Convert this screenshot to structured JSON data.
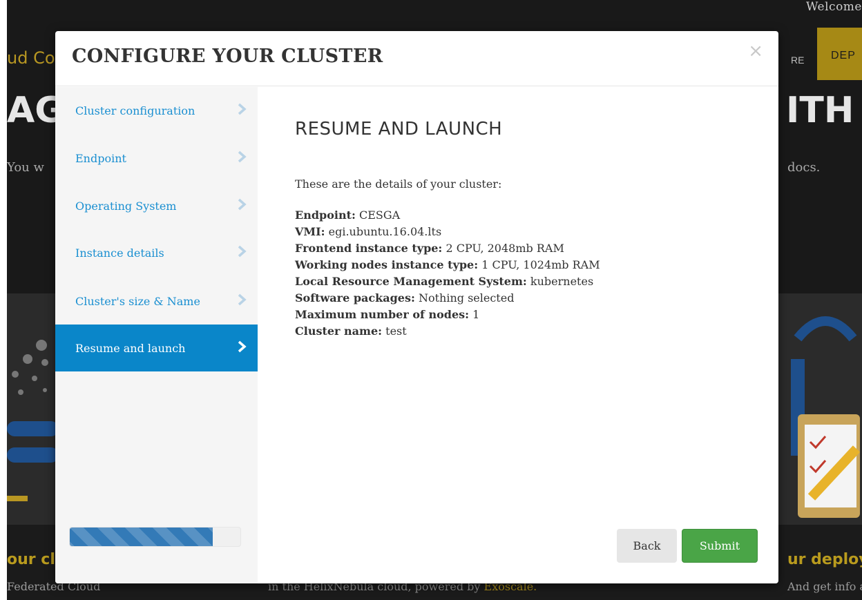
{
  "background": {
    "welcome_text": "Welcome",
    "brand_text": "ud Co",
    "nav_text": "RE",
    "nav_button_label": "DEP",
    "hero_left": "AG",
    "hero_right": "ITH I",
    "subtitle_left": "You w",
    "subtitle_right": "docs.",
    "footer_heading_left": "our cl",
    "footer_heading_right": "ur deploy",
    "footer_text_left": "Federated Cloud",
    "footer_text_mid": "in the HelixNebula cloud, powered by",
    "footer_link_mid": "Exoscale.",
    "footer_text_right": "And get info about"
  },
  "modal": {
    "title": "CONFIGURE YOUR CLUSTER",
    "close_symbol": "×",
    "steps": [
      {
        "label": "Cluster configuration",
        "active": false
      },
      {
        "label": "Endpoint",
        "active": false
      },
      {
        "label": "Operating System",
        "active": false
      },
      {
        "label": "Instance details",
        "active": false
      },
      {
        "label": "Cluster's size & Name",
        "active": false
      },
      {
        "label": "Resume and launch",
        "active": true
      }
    ],
    "progress_fraction": 0.84,
    "content": {
      "heading": "RESUME AND LAUNCH",
      "intro": "These are the details of your cluster:",
      "details": [
        {
          "label": "Endpoint:",
          "value": "CESGA"
        },
        {
          "label": "VMI:",
          "value": "egi.ubuntu.16.04.lts"
        },
        {
          "label": "Frontend instance type:",
          "value": "2 CPU, 2048mb RAM"
        },
        {
          "label": "Working nodes instance type:",
          "value": "1 CPU, 1024mb RAM"
        },
        {
          "label": "Local Resource Management System:",
          "value": "kubernetes"
        },
        {
          "label": "Software packages:",
          "value": "Nothing selected"
        },
        {
          "label": "Maximum number of nodes:",
          "value": "1"
        },
        {
          "label": "Cluster name:",
          "value": "test"
        }
      ]
    },
    "buttons": {
      "back_label": "Back",
      "submit_label": "Submit"
    }
  },
  "colors": {
    "accent_blue": "#0a86c9",
    "link_blue": "#1a8fd1",
    "submit_green": "#4aa547",
    "progress_blue": "#337ab7",
    "bg_gold": "#b89722"
  }
}
